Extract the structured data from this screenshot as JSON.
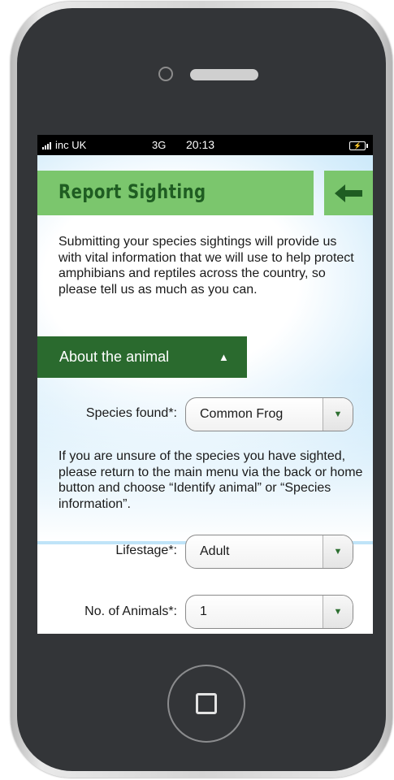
{
  "status_bar": {
    "carrier": "inc UK",
    "network": "3G",
    "time": "20:13",
    "battery_icon": "battery-charging-icon"
  },
  "header": {
    "title": "Report Sighting",
    "back_icon": "arrow-left-icon"
  },
  "intro_text": "Submitting your species sightings will provide us with vital information that we will use to help protect amphibians and reptiles across the country, so please tell us as much as you can.",
  "section": {
    "label": "About the animal",
    "toggle_glyph": "▲"
  },
  "form": {
    "species_label": "Species found*:",
    "species_value": "Common Frog",
    "help_text": "If you are unsure of the species you have sighted, please return to the main menu via the back or home button and choose “Identify animal” or “Species information”.",
    "lifestage_label": "Lifestage*:",
    "lifestage_value": "Adult",
    "count_label": "No. of Animals*:",
    "count_value": "1",
    "dropdown_glyph": "▼"
  },
  "colors": {
    "header_green": "#7bc66d",
    "title_green": "#1f5d22",
    "section_green": "#2a6a2e",
    "phone_body": "#333538"
  }
}
